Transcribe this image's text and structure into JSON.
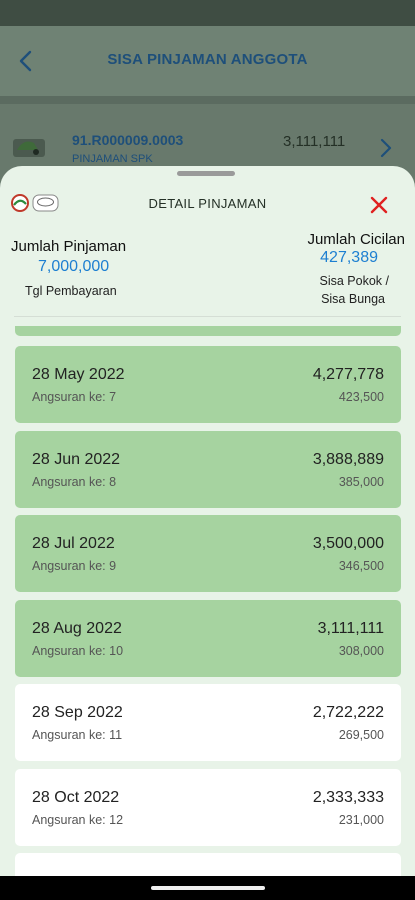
{
  "colors": {
    "accent": "#1d7fd1",
    "paid_row": "#a6d3a0",
    "close": "#e02020",
    "sheet_bg": "#e8f3e8"
  },
  "header": {
    "title": "SISA PINJAMAN ANGGOTA",
    "back_icon": "arrow-back-icon"
  },
  "background_card": {
    "code": "91.R000009.0003",
    "subtitle": "PINJAMAN SPK",
    "amount": "3,111,111",
    "icon": "chevron-right-icon"
  },
  "sheet": {
    "title": "DETAIL PINJAMAN",
    "close_icon": "close-icon",
    "summary": {
      "left_label": "Jumlah Pinjaman",
      "left_value": "7,000,000",
      "left_sub": "Tgl Pembayaran",
      "right_label": "Jumlah Cicilan",
      "right_value": "427,389",
      "right_sub_line1": "Sisa Pokok /",
      "right_sub_line2": "Sisa Bunga"
    },
    "installments": [
      {
        "date": "28 May 2022",
        "label": "Angsuran ke: 7",
        "pokok": "4,277,778",
        "bunga": "423,500",
        "paid": true
      },
      {
        "date": "28 Jun 2022",
        "label": "Angsuran ke: 8",
        "pokok": "3,888,889",
        "bunga": "385,000",
        "paid": true
      },
      {
        "date": "28 Jul 2022",
        "label": "Angsuran ke: 9",
        "pokok": "3,500,000",
        "bunga": "346,500",
        "paid": true
      },
      {
        "date": "28 Aug 2022",
        "label": "Angsuran ke: 10",
        "pokok": "3,111,111",
        "bunga": "308,000",
        "paid": true
      },
      {
        "date": "28 Sep 2022",
        "label": "Angsuran ke: 11",
        "pokok": "2,722,222",
        "bunga": "269,500",
        "paid": false
      },
      {
        "date": "28 Oct 2022",
        "label": "Angsuran ke: 12",
        "pokok": "2,333,333",
        "bunga": "231,000",
        "paid": false
      }
    ]
  }
}
